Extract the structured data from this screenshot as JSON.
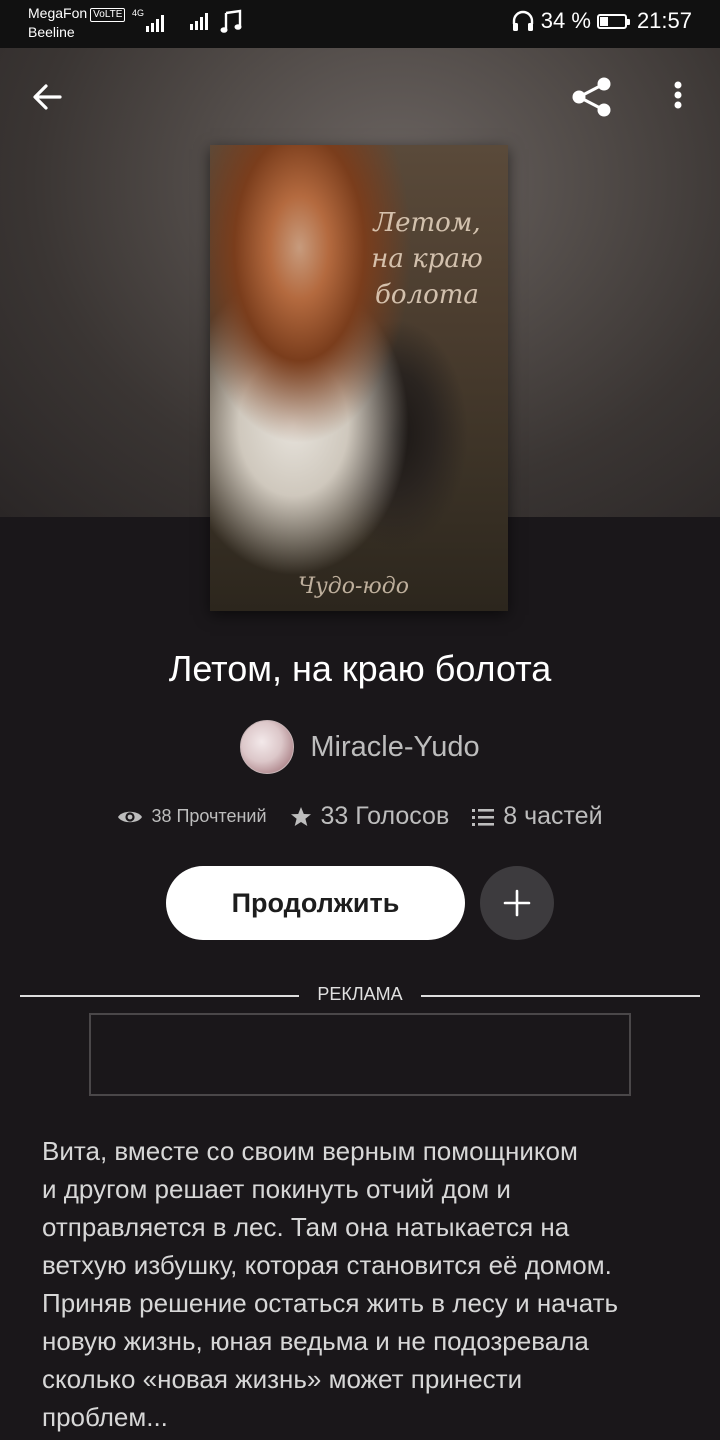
{
  "status_bar": {
    "carrier1": "MegaFon",
    "volte": "VoLTE",
    "carrier2": "Beeline",
    "network": "4G",
    "battery_percent": "34 %",
    "battery_level": 0.34,
    "time": "21:57"
  },
  "book": {
    "title": "Летом, на краю болота",
    "cover": {
      "title_line1": "Летом,",
      "title_line2": "на краю",
      "title_line3": "болота",
      "author": "Чудо-юдо"
    },
    "author": "Miracle-Yudo",
    "stats": {
      "reads": "38 Прочтений",
      "votes": "33 Голосов",
      "parts": "8 частей"
    },
    "continue_label": "Продолжить",
    "ad_label": "РЕКЛАМА",
    "description": "Вита, вместе со своим верным помощником\nи другом решает покинуть отчий дом и\nотправляется в лес. Там она натыкается на\nветхую избушку, которая становится её домом.\nПриняв решение остаться жить в лесу и начать\nновую жизнь, юная ведьма и не подозревала\nсколько «новая жизнь» может принести\nпроблем..."
  }
}
